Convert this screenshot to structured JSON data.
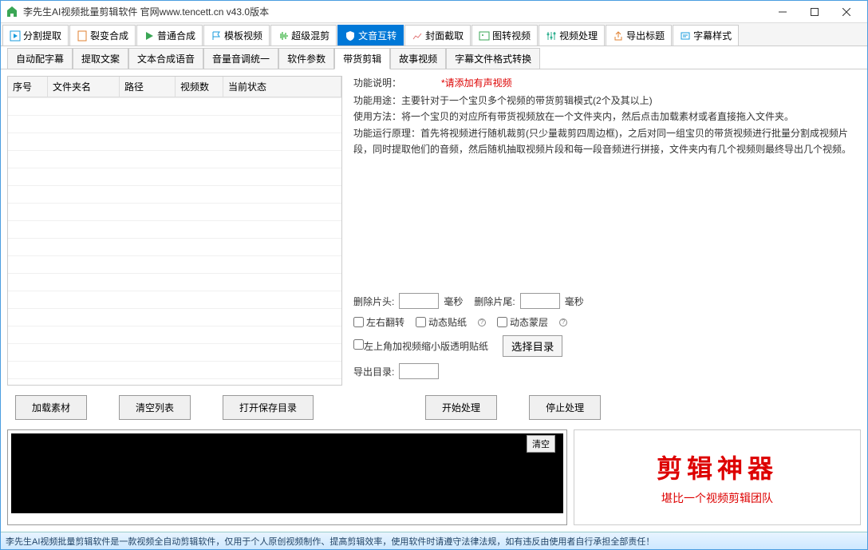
{
  "window": {
    "title": "李先生AI视频批量剪辑软件    官网www.tencett.cn    v43.0版本"
  },
  "main_tabs": [
    {
      "label": "分割提取",
      "color": "#1a9bdc"
    },
    {
      "label": "裂变合成",
      "color": "#e08030"
    },
    {
      "label": "普通合成",
      "color": "#3aa655"
    },
    {
      "label": "模板视频",
      "color": "#1a9bdc"
    },
    {
      "label": "超级混剪",
      "color": "#5ac060"
    },
    {
      "label": "文音互转",
      "active": true
    },
    {
      "label": "封面截取",
      "color": "#e07070"
    },
    {
      "label": "图转视频",
      "color": "#3aa655"
    },
    {
      "label": "视频处理",
      "color": "#30b090"
    },
    {
      "label": "导出标题",
      "color": "#e08030"
    },
    {
      "label": "字幕样式",
      "color": "#1a9bdc"
    }
  ],
  "sub_tabs": [
    {
      "label": "自动配字幕"
    },
    {
      "label": "提取文案"
    },
    {
      "label": "文本合成语音"
    },
    {
      "label": "音量音调统一"
    },
    {
      "label": "软件参数"
    },
    {
      "label": "带货剪辑",
      "active": true
    },
    {
      "label": "故事视频"
    },
    {
      "label": "字幕文件格式转换"
    }
  ],
  "table": {
    "headers": [
      "序号",
      "文件夹名",
      "路径",
      "视频数",
      "当前状态"
    ]
  },
  "desc": {
    "label": "功能说明：",
    "warn": "*请添加有声视频",
    "text": "功能用途：主要针对于一个宝贝多个视频的带货剪辑模式(2个及其以上)\n使用方法：将一个宝贝的对应所有带货视频放在一个文件夹内，然后点击加载素材或者直接拖入文件夹。\n功能运行原理：首先将视频进行随机裁剪(只少量裁剪四周边框)，之后对同一组宝贝的带货视频进行批量分割成视频片段，同时提取他们的音频，然后随机抽取视频片段和每一段音频进行拼接，文件夹内有几个视频则最终导出几个视频。"
  },
  "form": {
    "trim_head_label": "删除片头:",
    "trim_tail_label": "删除片尾:",
    "unit": "毫秒",
    "flip_label": "左右翻转",
    "sticker_label": "动态贴纸",
    "mask_label": "动态蒙层",
    "corner_label": "左上角加视频缩小版透明贴纸",
    "select_dir": "选择目录",
    "export_label": "导出目录:"
  },
  "buttons": {
    "load": "加载素材",
    "clear_list": "清空列表",
    "open_save": "打开保存目录",
    "start": "开始处理",
    "stop": "停止处理",
    "clear_log": "清空"
  },
  "brand": {
    "title": "剪辑神器",
    "sub": "堪比一个视频剪辑团队"
  },
  "footer": "李先生AI视频批量剪辑软件是一款视频全自动剪辑软件，仅用于个人原创视频制作、提高剪辑效率，使用软件时请遵守法律法规，如有违反由使用者自行承担全部责任！"
}
